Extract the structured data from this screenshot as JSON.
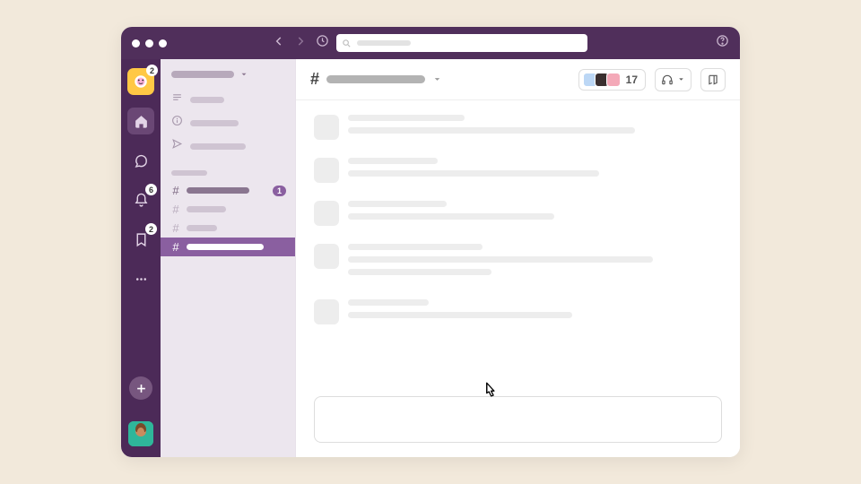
{
  "rail": {
    "workspace_badge": "2",
    "activity_badge": "6",
    "later_badge": "2"
  },
  "header": {
    "member_count": "17",
    "member_colors": [
      "#bcd7f5",
      "#3a2f2f",
      "#f4a9b8"
    ]
  },
  "sidebar": {
    "nav_widths": [
      38,
      54,
      62
    ],
    "channels": [
      {
        "width": 70,
        "bold": true,
        "badge": "1",
        "active": false
      },
      {
        "width": 44,
        "bold": false,
        "badge": null,
        "active": false
      },
      {
        "width": 34,
        "bold": false,
        "badge": null,
        "active": false
      },
      {
        "width": 86,
        "bold": false,
        "badge": null,
        "active": true
      }
    ]
  },
  "messages": [
    {
      "lines": [
        130,
        320
      ]
    },
    {
      "lines": [
        100,
        280
      ]
    },
    {
      "lines": [
        110,
        230
      ]
    },
    {
      "lines": [
        150,
        340,
        160
      ]
    },
    {
      "lines": [
        90,
        250
      ]
    }
  ]
}
